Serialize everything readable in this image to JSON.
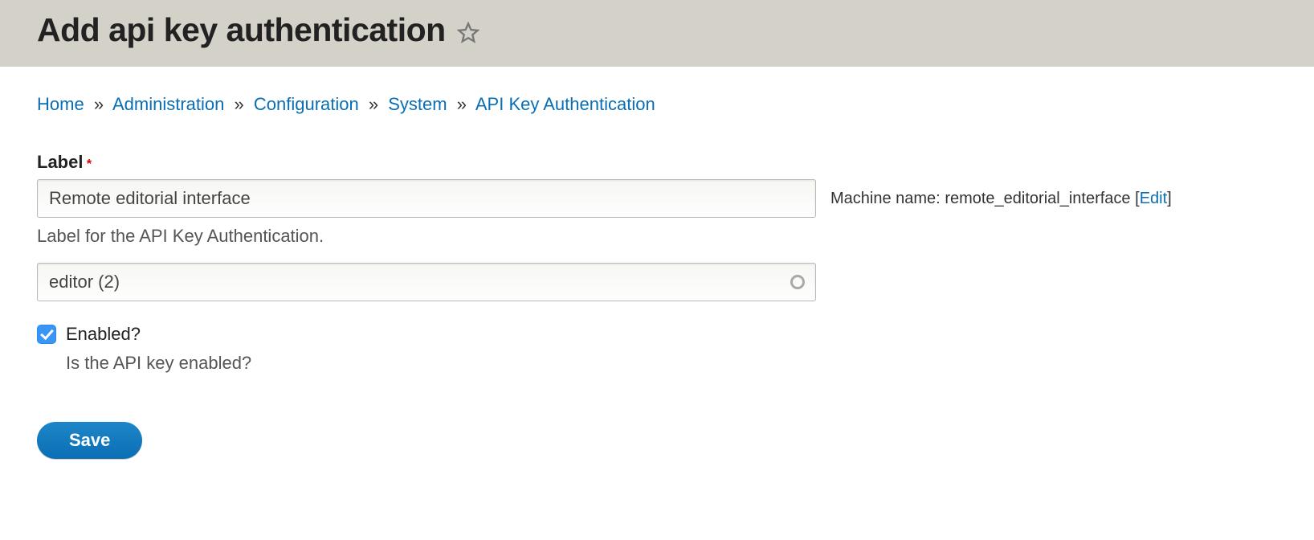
{
  "header": {
    "title": "Add api key authentication"
  },
  "breadcrumb": {
    "items": [
      {
        "label": "Home"
      },
      {
        "label": "Administration"
      },
      {
        "label": "Configuration"
      },
      {
        "label": "System"
      },
      {
        "label": "API Key Authentication"
      }
    ],
    "separator": "»"
  },
  "form": {
    "label_field": {
      "label": "Label",
      "required_marker": "*",
      "value": "Remote editorial interface",
      "description": "Label for the API Key Authentication."
    },
    "machine_name": {
      "prefix": "Machine name:",
      "value": "remote_editorial_interface",
      "edit_label": "Edit"
    },
    "user_field": {
      "value": "editor (2)"
    },
    "enabled": {
      "label": "Enabled?",
      "checked": true,
      "description": "Is the API key enabled?"
    },
    "save_label": "Save"
  }
}
